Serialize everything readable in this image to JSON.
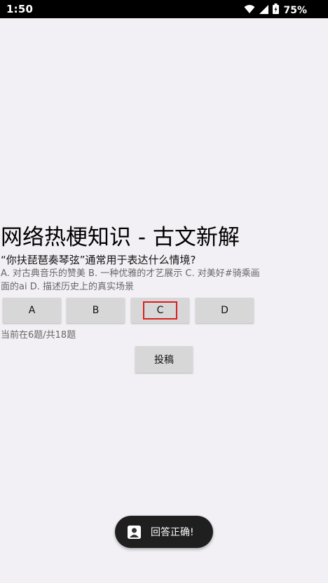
{
  "status_bar": {
    "time": "1:50",
    "battery_percent": "75%",
    "icons": [
      "wifi-icon",
      "signal-icon",
      "battery-charging-icon"
    ]
  },
  "quiz": {
    "title": "网络热梗知识 - 古文新解",
    "question": "“你扶琵琶奏琴弦”通常用于表达什么情境?",
    "options_text": "A. 对古典音乐的赞美  B. 一种优雅的才艺展示  C. 对美好#骑乘画面的ai  D. 描述历史上的真实场景",
    "choices": [
      {
        "label": "A",
        "selected": false
      },
      {
        "label": "B",
        "selected": false
      },
      {
        "label": "C",
        "selected": true
      },
      {
        "label": "D",
        "selected": false
      }
    ],
    "progress": "当前在6题/共18题",
    "submit_label": "投稿"
  },
  "toast": {
    "text": "回答正确!",
    "icon": "app-icon"
  },
  "colors": {
    "background": "#f2f0f5",
    "button": "#d7d7d7",
    "selected_outline": "#d9201e",
    "toast_bg": "#1f1f1f"
  }
}
